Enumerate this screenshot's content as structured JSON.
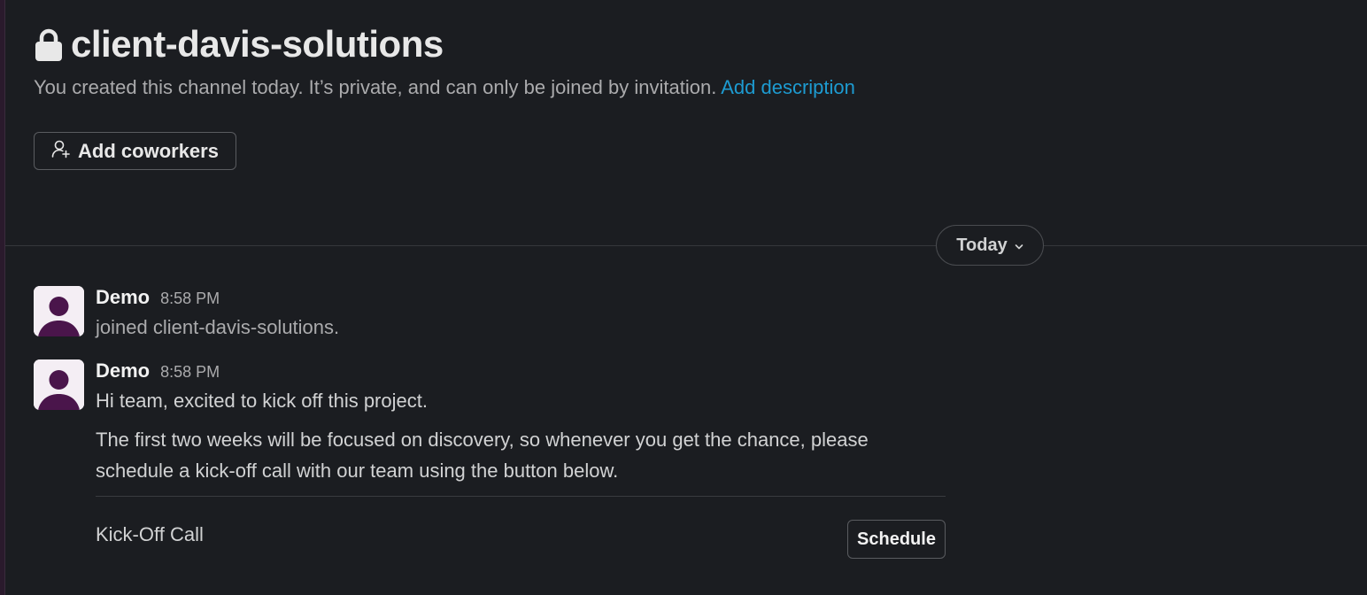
{
  "channel": {
    "name": "client-davis-solutions",
    "intro_text": "You created this channel today. It’s private, and can only be joined by invitation.",
    "add_description_label": "Add description",
    "add_coworkers_label": "Add coworkers"
  },
  "date_divider": {
    "label": "Today"
  },
  "messages": [
    {
      "author": "Demo",
      "time": "8:58 PM",
      "text": "joined client-davis-solutions."
    },
    {
      "author": "Demo",
      "time": "8:58 PM",
      "text": "Hi team, excited to kick off this project.",
      "paragraph": "The first two weeks will be focused on discovery, so whenever you get the chance, please schedule a kick-off call with our team using the button below.",
      "block": {
        "label": "Kick-Off Call",
        "button_label": "Schedule"
      }
    }
  ],
  "icons": {
    "lock": "lock-icon",
    "add_user": "add-user-icon",
    "chevron": "chevron-down-icon",
    "avatar": "avatar-person-icon"
  },
  "colors": {
    "background": "#1b1d21",
    "link": "#1d9bd1",
    "avatar_bg": "#f4eef4",
    "avatar_fg": "#4a154b"
  }
}
